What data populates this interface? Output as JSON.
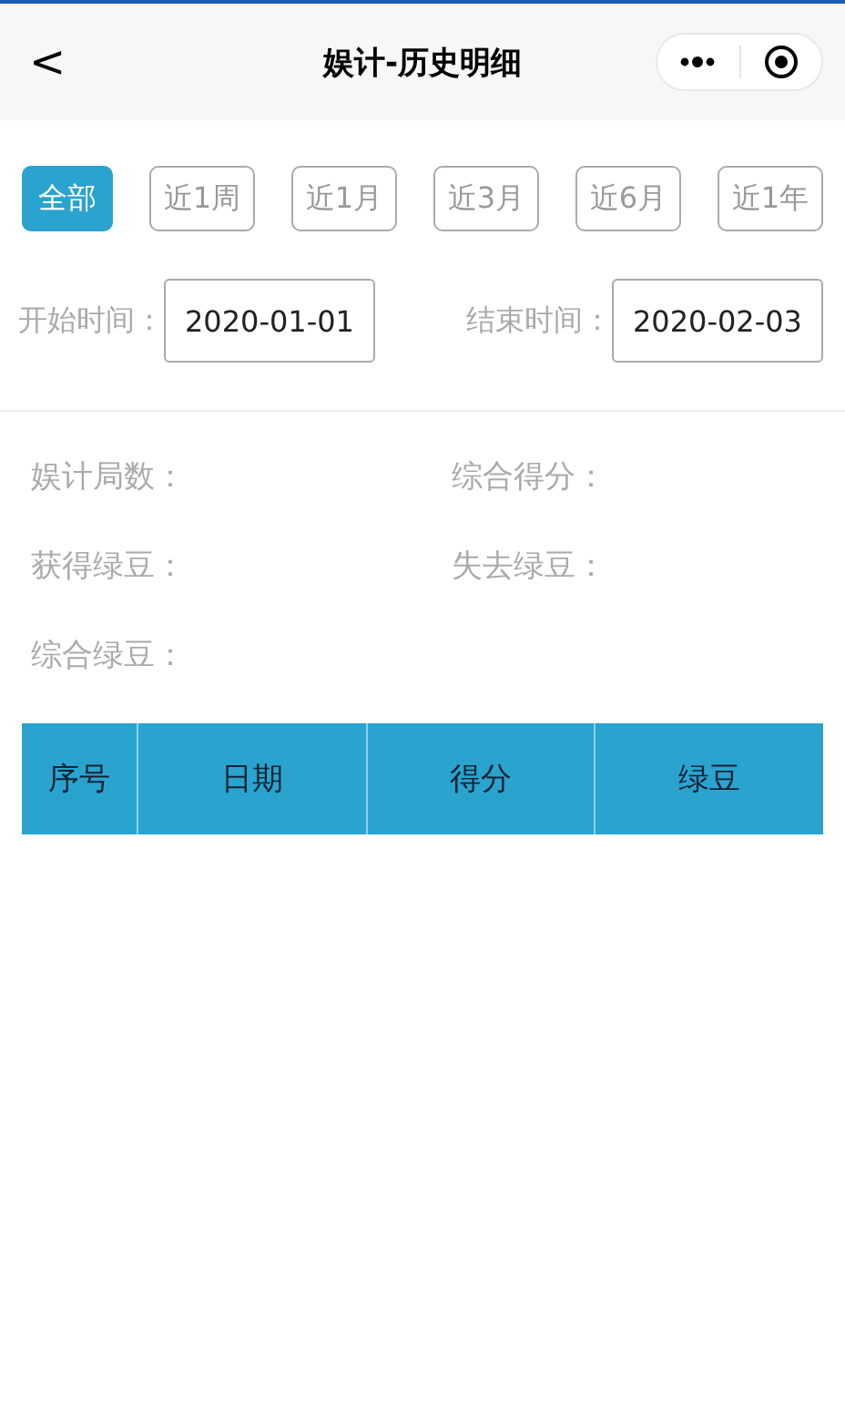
{
  "nav": {
    "title": "娱计-历史明细",
    "back": "<"
  },
  "filters": [
    {
      "label": "全部",
      "selected": true
    },
    {
      "label": "近1周",
      "selected": false
    },
    {
      "label": "近1月",
      "selected": false
    },
    {
      "label": "近3月",
      "selected": false
    },
    {
      "label": "近6月",
      "selected": false
    },
    {
      "label": "近1年",
      "selected": false
    }
  ],
  "date_range": [
    {
      "label": "开始时间：",
      "value": "2020-01-01"
    },
    {
      "label": "结束时间：",
      "value": "2020-02-03"
    }
  ],
  "stats": [
    "娱计局数：",
    "综合得分：",
    "获得绿豆：",
    "失去绿豆：",
    "综合绿豆："
  ],
  "table": {
    "columns": [
      "序号",
      "日期",
      "得分",
      "绿豆"
    ]
  }
}
